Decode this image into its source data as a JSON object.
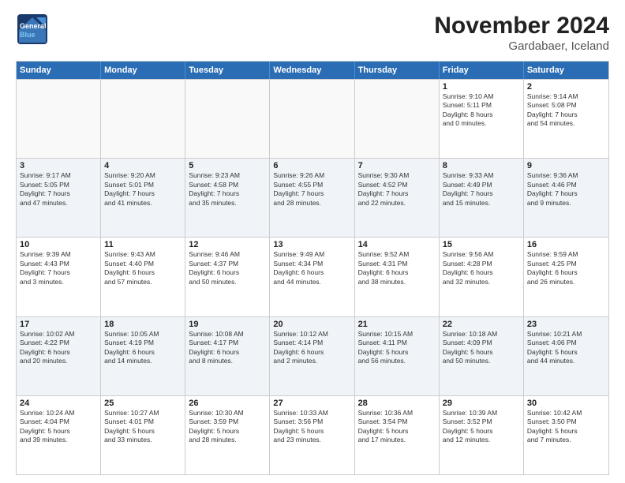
{
  "logo": {
    "general": "General",
    "blue": "Blue"
  },
  "title": "November 2024",
  "subtitle": "Gardabaer, Iceland",
  "days_of_week": [
    "Sunday",
    "Monday",
    "Tuesday",
    "Wednesday",
    "Thursday",
    "Friday",
    "Saturday"
  ],
  "weeks": [
    [
      {
        "day": "",
        "info": "",
        "empty": true
      },
      {
        "day": "",
        "info": "",
        "empty": true
      },
      {
        "day": "",
        "info": "",
        "empty": true
      },
      {
        "day": "",
        "info": "",
        "empty": true
      },
      {
        "day": "",
        "info": "",
        "empty": true
      },
      {
        "day": "1",
        "info": "Sunrise: 9:10 AM\nSunset: 5:11 PM\nDaylight: 8 hours\nand 0 minutes."
      },
      {
        "day": "2",
        "info": "Sunrise: 9:14 AM\nSunset: 5:08 PM\nDaylight: 7 hours\nand 54 minutes."
      }
    ],
    [
      {
        "day": "3",
        "info": "Sunrise: 9:17 AM\nSunset: 5:05 PM\nDaylight: 7 hours\nand 47 minutes."
      },
      {
        "day": "4",
        "info": "Sunrise: 9:20 AM\nSunset: 5:01 PM\nDaylight: 7 hours\nand 41 minutes."
      },
      {
        "day": "5",
        "info": "Sunrise: 9:23 AM\nSunset: 4:58 PM\nDaylight: 7 hours\nand 35 minutes."
      },
      {
        "day": "6",
        "info": "Sunrise: 9:26 AM\nSunset: 4:55 PM\nDaylight: 7 hours\nand 28 minutes."
      },
      {
        "day": "7",
        "info": "Sunrise: 9:30 AM\nSunset: 4:52 PM\nDaylight: 7 hours\nand 22 minutes."
      },
      {
        "day": "8",
        "info": "Sunrise: 9:33 AM\nSunset: 4:49 PM\nDaylight: 7 hours\nand 15 minutes."
      },
      {
        "day": "9",
        "info": "Sunrise: 9:36 AM\nSunset: 4:46 PM\nDaylight: 7 hours\nand 9 minutes."
      }
    ],
    [
      {
        "day": "10",
        "info": "Sunrise: 9:39 AM\nSunset: 4:43 PM\nDaylight: 7 hours\nand 3 minutes."
      },
      {
        "day": "11",
        "info": "Sunrise: 9:43 AM\nSunset: 4:40 PM\nDaylight: 6 hours\nand 57 minutes."
      },
      {
        "day": "12",
        "info": "Sunrise: 9:46 AM\nSunset: 4:37 PM\nDaylight: 6 hours\nand 50 minutes."
      },
      {
        "day": "13",
        "info": "Sunrise: 9:49 AM\nSunset: 4:34 PM\nDaylight: 6 hours\nand 44 minutes."
      },
      {
        "day": "14",
        "info": "Sunrise: 9:52 AM\nSunset: 4:31 PM\nDaylight: 6 hours\nand 38 minutes."
      },
      {
        "day": "15",
        "info": "Sunrise: 9:56 AM\nSunset: 4:28 PM\nDaylight: 6 hours\nand 32 minutes."
      },
      {
        "day": "16",
        "info": "Sunrise: 9:59 AM\nSunset: 4:25 PM\nDaylight: 6 hours\nand 26 minutes."
      }
    ],
    [
      {
        "day": "17",
        "info": "Sunrise: 10:02 AM\nSunset: 4:22 PM\nDaylight: 6 hours\nand 20 minutes."
      },
      {
        "day": "18",
        "info": "Sunrise: 10:05 AM\nSunset: 4:19 PM\nDaylight: 6 hours\nand 14 minutes."
      },
      {
        "day": "19",
        "info": "Sunrise: 10:08 AM\nSunset: 4:17 PM\nDaylight: 6 hours\nand 8 minutes."
      },
      {
        "day": "20",
        "info": "Sunrise: 10:12 AM\nSunset: 4:14 PM\nDaylight: 6 hours\nand 2 minutes."
      },
      {
        "day": "21",
        "info": "Sunrise: 10:15 AM\nSunset: 4:11 PM\nDaylight: 5 hours\nand 56 minutes."
      },
      {
        "day": "22",
        "info": "Sunrise: 10:18 AM\nSunset: 4:09 PM\nDaylight: 5 hours\nand 50 minutes."
      },
      {
        "day": "23",
        "info": "Sunrise: 10:21 AM\nSunset: 4:06 PM\nDaylight: 5 hours\nand 44 minutes."
      }
    ],
    [
      {
        "day": "24",
        "info": "Sunrise: 10:24 AM\nSunset: 4:04 PM\nDaylight: 5 hours\nand 39 minutes."
      },
      {
        "day": "25",
        "info": "Sunrise: 10:27 AM\nSunset: 4:01 PM\nDaylight: 5 hours\nand 33 minutes."
      },
      {
        "day": "26",
        "info": "Sunrise: 10:30 AM\nSunset: 3:59 PM\nDaylight: 5 hours\nand 28 minutes."
      },
      {
        "day": "27",
        "info": "Sunrise: 10:33 AM\nSunset: 3:56 PM\nDaylight: 5 hours\nand 23 minutes."
      },
      {
        "day": "28",
        "info": "Sunrise: 10:36 AM\nSunset: 3:54 PM\nDaylight: 5 hours\nand 17 minutes."
      },
      {
        "day": "29",
        "info": "Sunrise: 10:39 AM\nSunset: 3:52 PM\nDaylight: 5 hours\nand 12 minutes."
      },
      {
        "day": "30",
        "info": "Sunrise: 10:42 AM\nSunset: 3:50 PM\nDaylight: 5 hours\nand 7 minutes."
      }
    ]
  ]
}
